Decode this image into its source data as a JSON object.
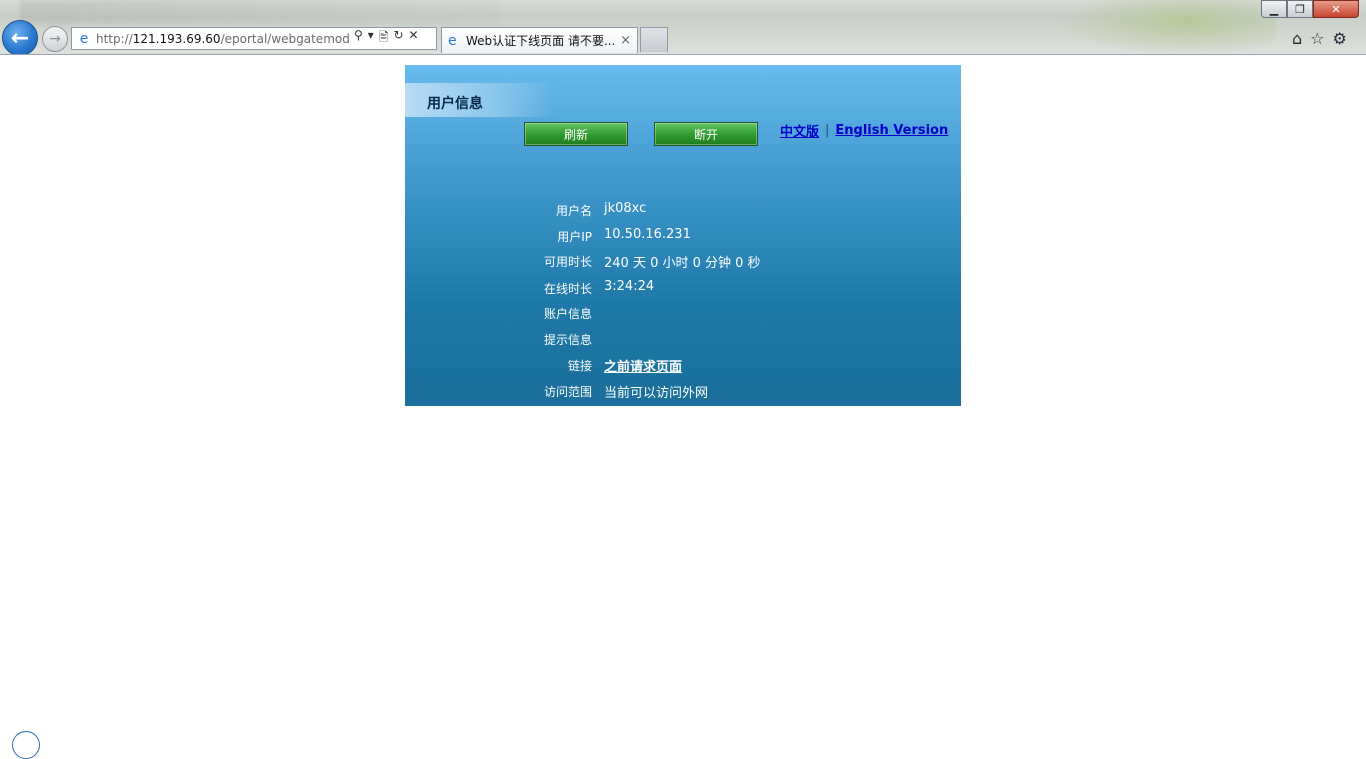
{
  "browser": {
    "url_prefix": "http://",
    "url_host": "121.193.69.60",
    "url_path": "/eportal/webgatemode,",
    "tab_title": "Web认证下线页面 请不要...",
    "tab_close": "×",
    "addr_tools": [
      "⚲",
      "▾",
      "🖹",
      "↻",
      "✕"
    ],
    "window_controls": {
      "minimize": "▁",
      "maximize": "❐",
      "close": "✕"
    }
  },
  "panel": {
    "title": "用户信息",
    "buttons": {
      "refresh": "刷新",
      "disconnect": "断开"
    },
    "lang": {
      "chinese": "中文版",
      "separator": "|",
      "english": "English Version"
    },
    "rows": [
      {
        "label": "用户名",
        "value": "jk08xc"
      },
      {
        "label": "用户IP",
        "value": "10.50.16.231"
      },
      {
        "label": "可用时长",
        "value": "240 天 0 小时 0 分钟 0 秒"
      },
      {
        "label": "在线时长",
        "value": "3:24:24"
      },
      {
        "label": "账户信息",
        "value": ""
      },
      {
        "label": "提示信息",
        "value": ""
      },
      {
        "label": "链接",
        "value": "之前请求页面"
      },
      {
        "label": "访问范围",
        "value": "当前可以访问外网"
      }
    ]
  },
  "colors": {
    "panel_top": "#68bbee",
    "panel_bottom": "#1a6e9a",
    "button_green": "#2f9a2f",
    "link_blue": "#0000cc"
  }
}
